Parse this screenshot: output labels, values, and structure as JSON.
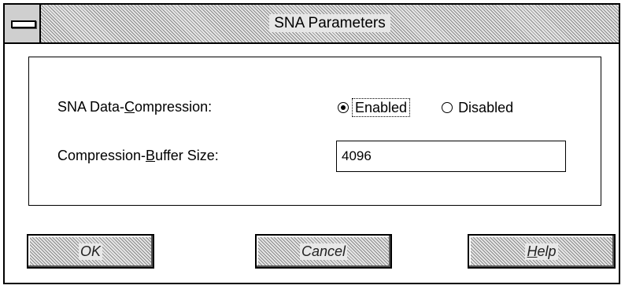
{
  "window": {
    "title": "SNA Parameters"
  },
  "form": {
    "compression_label_prefix": "SNA Data-",
    "compression_label_mnemonic": "C",
    "compression_label_suffix": "ompression:",
    "compression_options": [
      {
        "label": "Enabled",
        "selected": true
      },
      {
        "label": "Disabled",
        "selected": false
      }
    ],
    "buffer_label_prefix": "Compression-",
    "buffer_label_mnemonic": "B",
    "buffer_label_suffix": "uffer Size:",
    "buffer_size_value": "4096"
  },
  "buttons": {
    "ok_label": "OK",
    "cancel_label": "Cancel",
    "help_mnemonic": "H",
    "help_suffix": "elp"
  },
  "icons": {
    "system_menu": "system-menu-icon"
  }
}
